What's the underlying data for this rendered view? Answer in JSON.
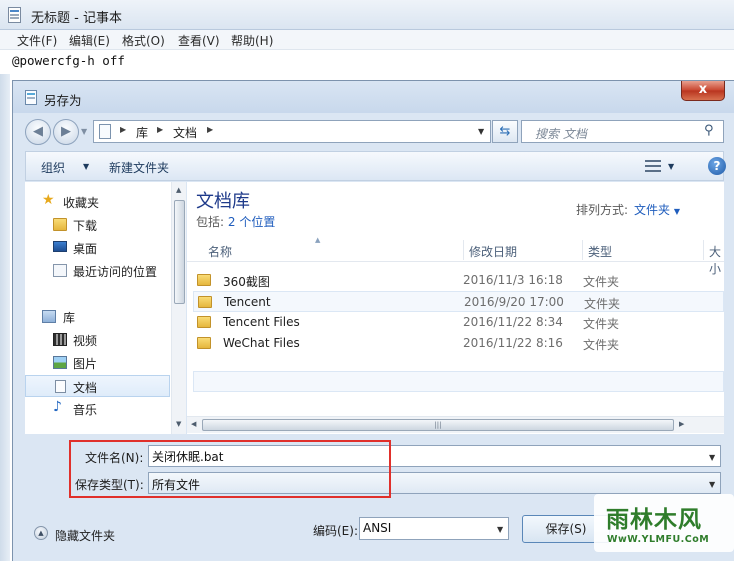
{
  "notepad": {
    "title": "无标题 - 记事本",
    "menu": [
      "文件(F)",
      "编辑(E)",
      "格式(O)",
      "查看(V)",
      "帮助(H)"
    ],
    "text": "@powercfg-h off"
  },
  "dialog": {
    "title": "另存为",
    "close_label": "x",
    "address": {
      "segments": [
        "库",
        "文档"
      ]
    },
    "search_placeholder": "搜索 文档",
    "toolbar": {
      "organize": "组织",
      "new_folder": "新建文件夹"
    },
    "nav": {
      "items": [
        {
          "label": "收藏夹",
          "icon": "star-icon"
        },
        {
          "label": "下载",
          "icon": "downloads-folder-icon"
        },
        {
          "label": "桌面",
          "icon": "desktop-icon"
        },
        {
          "label": "最近访问的位置",
          "icon": "recent-places-icon"
        },
        {
          "label": "库",
          "icon": "libraries-icon"
        },
        {
          "label": "视频",
          "icon": "video-icon"
        },
        {
          "label": "图片",
          "icon": "pictures-icon"
        },
        {
          "label": "文档",
          "icon": "documents-icon",
          "selected": true
        },
        {
          "label": "音乐",
          "icon": "music-icon"
        }
      ]
    },
    "library": {
      "title": "文档库",
      "includes_prefix": "包括:",
      "includes_link": "2 个位置",
      "arrange_label": "排列方式:",
      "arrange_value": "文件夹"
    },
    "columns": {
      "name": "名称",
      "date": "修改日期",
      "type": "类型",
      "size": "大小"
    },
    "files": [
      {
        "name": "360截图",
        "date": "2016/11/3 16:18",
        "type": "文件夹"
      },
      {
        "name": "Tencent",
        "date": "2016/9/20 17:00",
        "type": "文件夹"
      },
      {
        "name": "Tencent Files",
        "date": "2016/11/22 8:34",
        "type": "文件夹"
      },
      {
        "name": "WeChat Files",
        "date": "2016/11/22 8:16",
        "type": "文件夹"
      }
    ],
    "form": {
      "filename_label": "文件名(N):",
      "filename_value": "关闭休眠.bat",
      "filetype_label": "保存类型(T):",
      "filetype_value": "所有文件",
      "hide_folders": "隐藏文件夹",
      "encoding_label": "编码(E):",
      "encoding_value": "ANSI",
      "save_button": "保存(S)"
    },
    "highlight_color": "#e0302b"
  },
  "watermark": {
    "brand": "雨林木风",
    "url": "WwW.YLMFU.CoM"
  }
}
